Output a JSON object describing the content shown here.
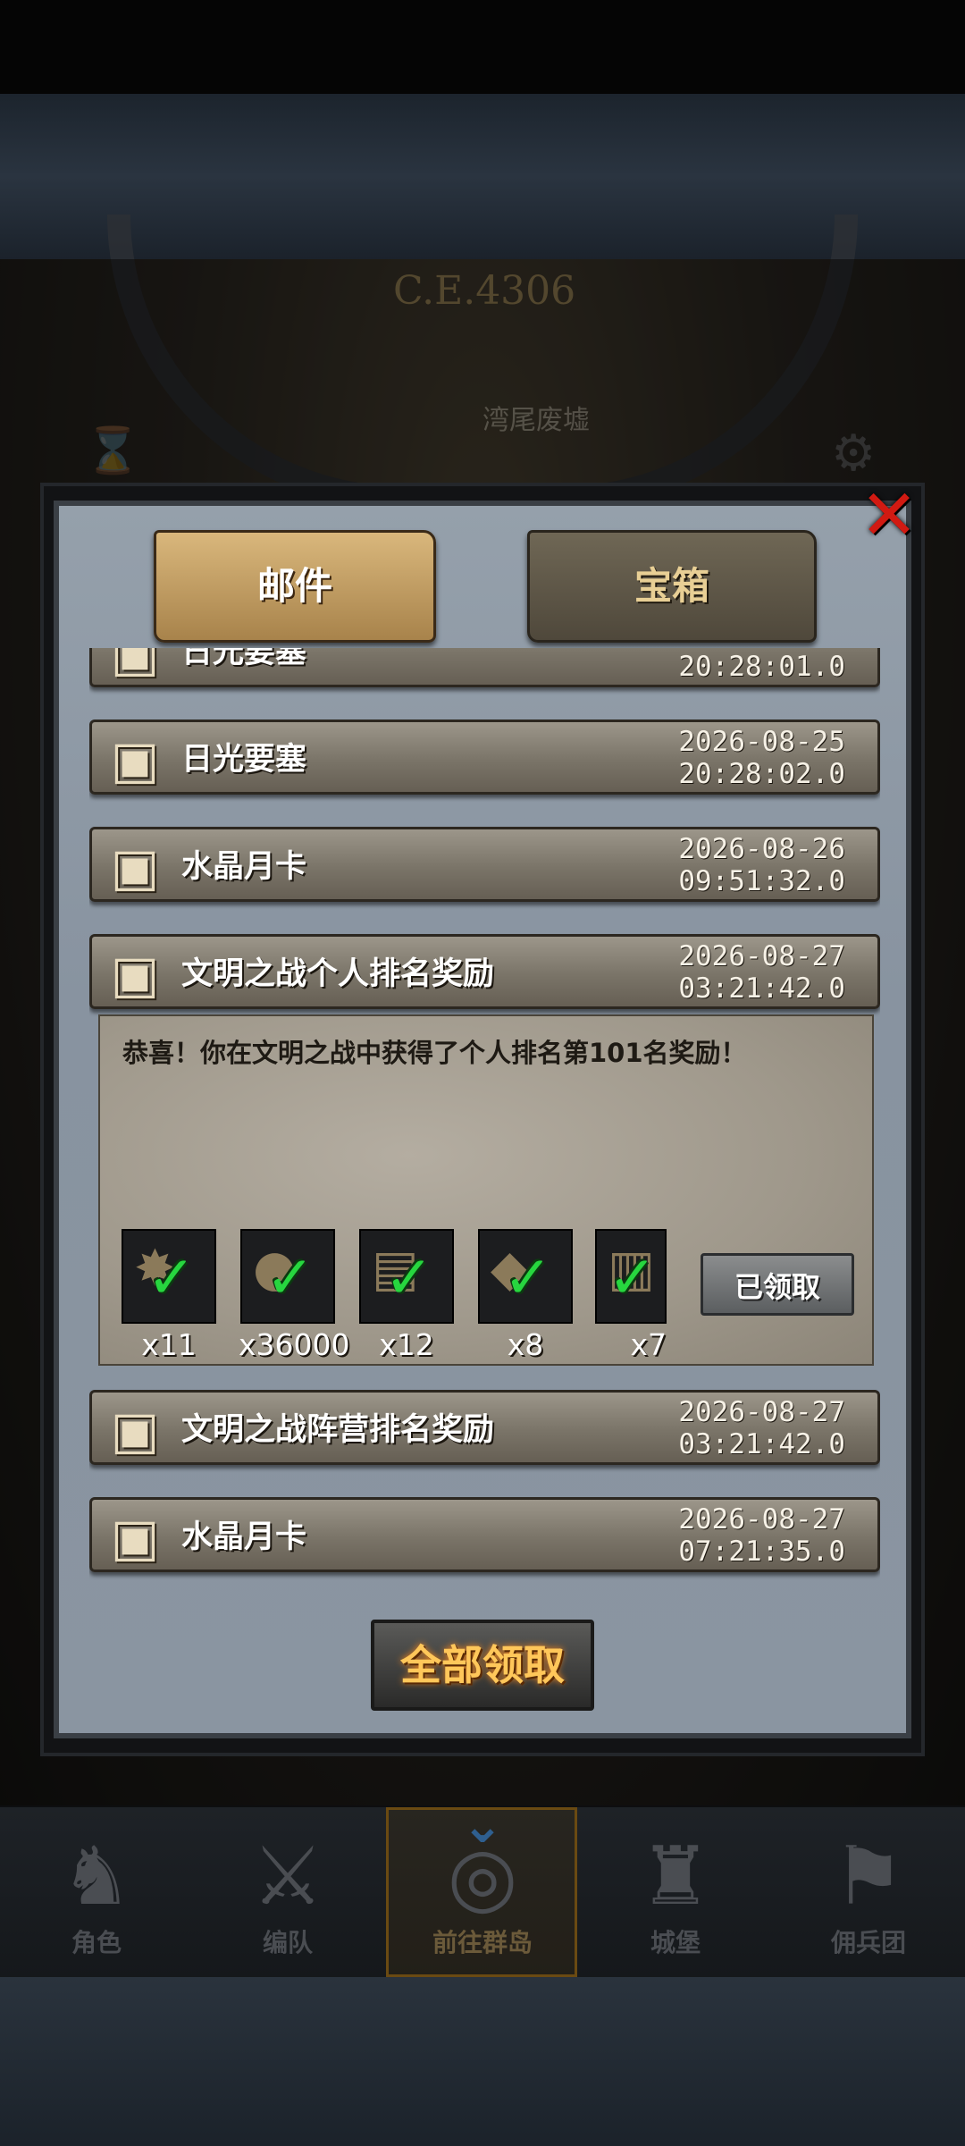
{
  "background": {
    "era": "C.E.4306",
    "location": "湾尾废墟"
  },
  "tabs": [
    {
      "label": "邮件",
      "active": true
    },
    {
      "label": "宝箱",
      "active": false
    }
  ],
  "mails": [
    {
      "title": "日光要塞",
      "date": "",
      "time": "20:28:01.0",
      "icon": "chest-icon"
    },
    {
      "title": "日光要塞",
      "date": "2026-08-25",
      "time": "20:28:02.0",
      "icon": "chest-icon"
    },
    {
      "title": "水晶月卡",
      "date": "2026-08-26",
      "time": "09:51:32.0",
      "icon": "chest-icon"
    },
    {
      "title": "文明之战个人排名奖励",
      "date": "2026-08-27",
      "time": "03:21:42.0",
      "icon": "chest-open-icon"
    },
    {
      "title": "文明之战阵营排名奖励",
      "date": "2026-08-27",
      "time": "03:21:42.0",
      "icon": "chest-icon"
    },
    {
      "title": "水晶月卡",
      "date": "2026-08-27",
      "time": "07:21:35.0",
      "icon": "chest-closed-icon"
    }
  ],
  "expanded_mail": {
    "message": "恭喜！你在文明之战中获得了个人排名第101名奖励！",
    "rewards": [
      {
        "qty": "x11",
        "icon": "star-medal-icon"
      },
      {
        "qty": "x36000",
        "icon": "silver-coin-icon"
      },
      {
        "qty": "x12",
        "icon": "treasure-chest-icon"
      },
      {
        "qty": "x8",
        "icon": "ore-icon"
      },
      {
        "qty": "x7",
        "icon": "wood-log-icon"
      }
    ],
    "claimed_label": "已领取"
  },
  "claim_all_label": "全部领取",
  "nav": [
    {
      "label": "角色",
      "icon": "knight-icon"
    },
    {
      "label": "编队",
      "icon": "formation-icon"
    },
    {
      "label": "前往群岛",
      "icon": "compass-icon",
      "active": true
    },
    {
      "label": "城堡",
      "icon": "castle-icon"
    },
    {
      "label": "佣兵团",
      "icon": "mercenary-icon"
    }
  ],
  "colors": {
    "claim_all_text": "#ffc75a",
    "check": "#27d63f",
    "close": "#d11a12"
  }
}
